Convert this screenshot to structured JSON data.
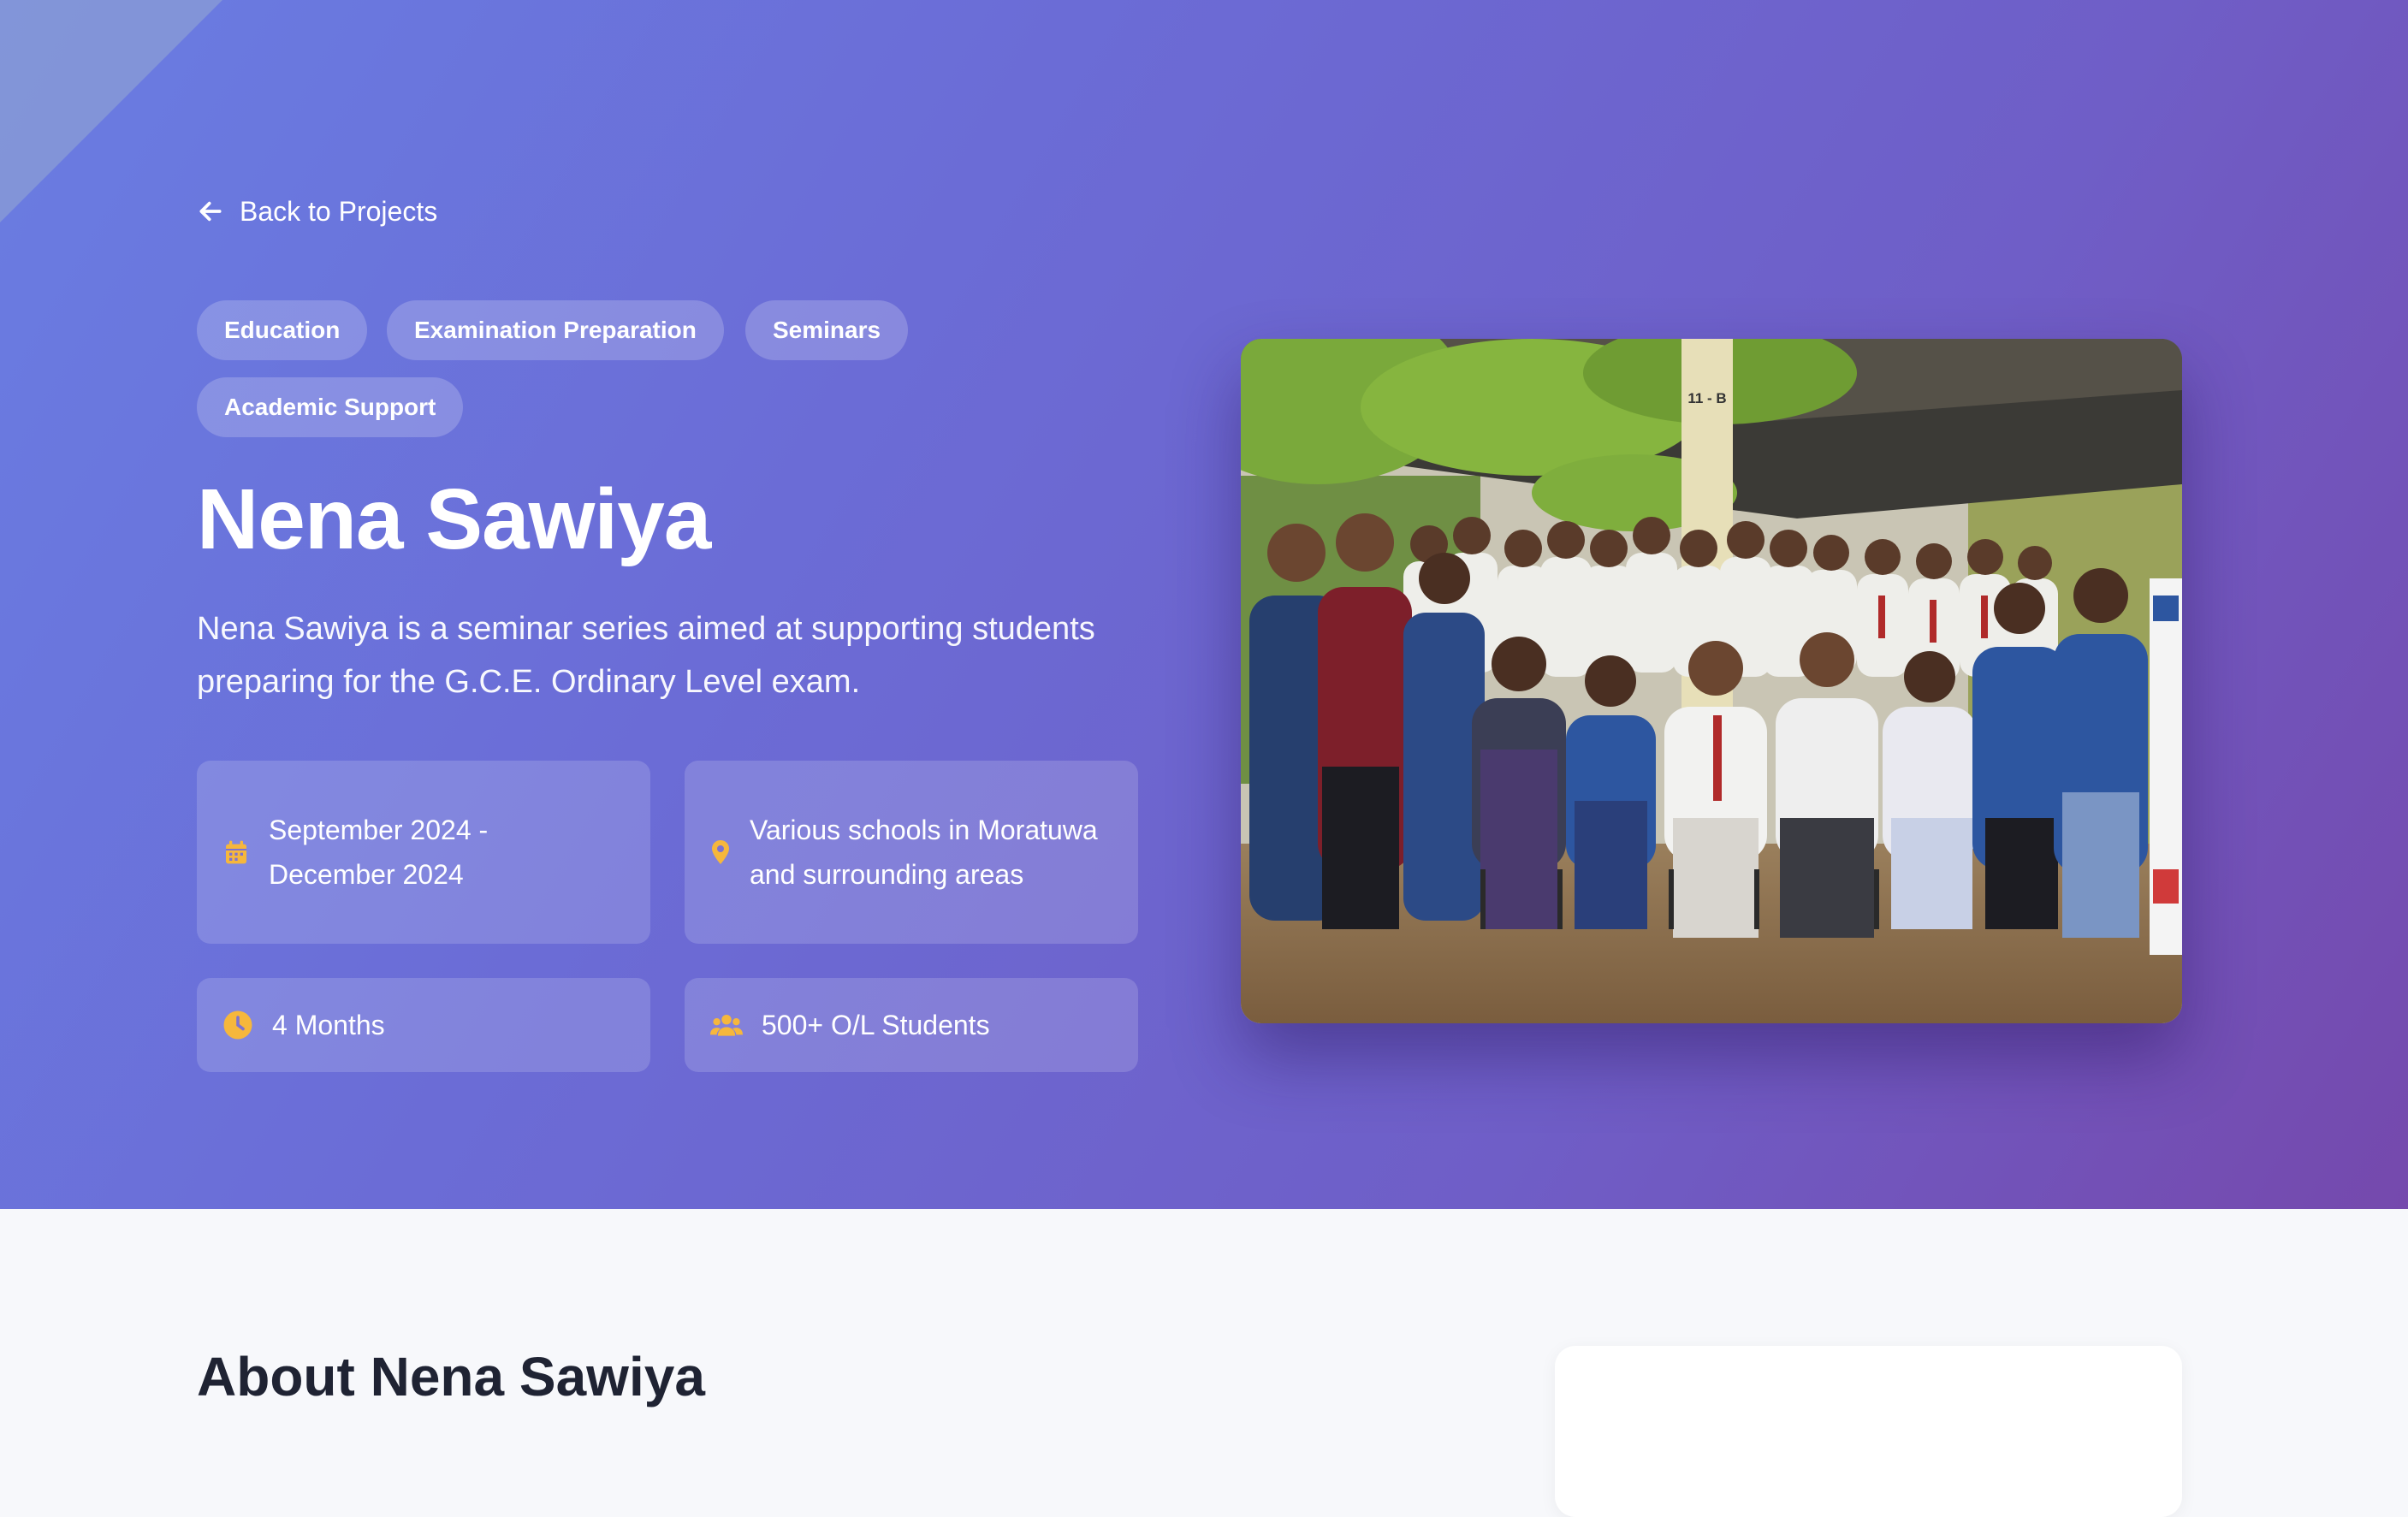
{
  "nav": {
    "back_label": "Back to Projects",
    "back_icon": "arrow-left-icon"
  },
  "tags": [
    "Education",
    "Examination Preparation",
    "Seminars",
    "Academic Support"
  ],
  "project": {
    "title": "Nena Sawiya",
    "description": "Nena Sawiya is a seminar series aimed at supporting students preparing for the G.C.E. Ordinary Level exam."
  },
  "info": {
    "date": "September 2024 - December 2024",
    "location": "Various schools in Moratuwa and surrounding areas",
    "duration": "4 Months",
    "participants": "500+ O/L Students"
  },
  "icons": {
    "date": "calendar-icon",
    "location": "map-pin-icon",
    "duration": "clock-icon",
    "participants": "users-icon"
  },
  "photo": {
    "sign_text": "11 - B"
  },
  "about": {
    "title": "About Nena Sawiya"
  },
  "colors": {
    "hero_gradient_start": "#6a7de2",
    "hero_gradient_end": "#7549ad",
    "icon_accent": "#f6b73c",
    "page_background": "#f7f8fb"
  }
}
